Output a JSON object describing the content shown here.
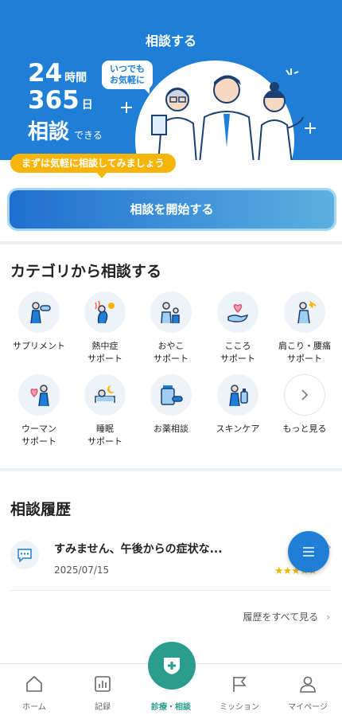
{
  "hero": {
    "title": "相談する",
    "stat1_num": "24",
    "stat1_unit": "時間",
    "stat2_num": "365",
    "stat2_unit": "日",
    "stat3_word": "相談",
    "stat3_suffix": "できる",
    "bubble_line1": "いつでも",
    "bubble_line2": "お気軽に",
    "callout": "まずは気軽に相談してみましょう"
  },
  "start_button": "相談を開始する",
  "categories": {
    "title": "カテゴリから相談する",
    "items": [
      {
        "label": "サプリメント",
        "icon": "supplement-icon"
      },
      {
        "label": "熱中症\nサポート",
        "icon": "heatstroke-icon"
      },
      {
        "label": "おやこ\nサポート",
        "icon": "parent-child-icon"
      },
      {
        "label": "こころ\nサポート",
        "icon": "heart-hand-icon"
      },
      {
        "label": "肩こり・腰痛\nサポート",
        "icon": "back-pain-icon"
      },
      {
        "label": "ウーマン\nサポート",
        "icon": "woman-icon"
      },
      {
        "label": "睡眠\nサポート",
        "icon": "sleep-icon"
      },
      {
        "label": "お薬相談",
        "icon": "medicine-icon"
      },
      {
        "label": "スキンケア",
        "icon": "skincare-icon"
      },
      {
        "label": "もっと見る",
        "icon": "chevron-right-icon"
      }
    ]
  },
  "history": {
    "title": "相談履歴",
    "item_text": "すみません、午後からの症状な...",
    "item_date": "2025/07/15",
    "rating": "★★★★★",
    "see_all": "履歴をすべて見る"
  },
  "nav": {
    "home": "ホーム",
    "records": "記録",
    "consult": "診療・相談",
    "mission": "ミッション",
    "mypage": "マイページ"
  },
  "colors": {
    "primary": "#1f7fd6",
    "accent_yellow": "#f5b50a",
    "teal": "#2a9d8f"
  }
}
